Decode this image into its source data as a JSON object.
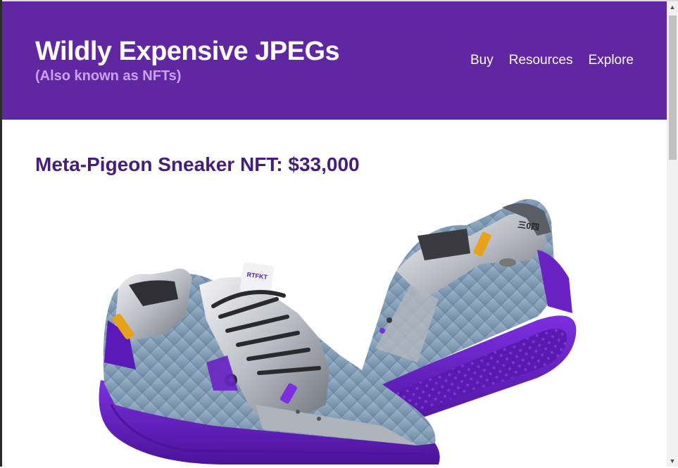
{
  "header": {
    "title": "Wildly Expensive JPEGs",
    "subtitle": "(Also known as NFTs)",
    "nav": [
      {
        "label": "Buy"
      },
      {
        "label": "Resources"
      },
      {
        "label": "Explore"
      }
    ]
  },
  "main": {
    "product_title": "Meta-Pigeon Sneaker NFT: $33,000",
    "image": {
      "subject": "pair of purple and silver sneakers",
      "tongue_text": "RTFKT"
    }
  },
  "colors": {
    "header_bg": "#6127a3",
    "title_text": "#ffffff",
    "subtitle_text": "#c9a2f4",
    "product_title_text": "#451d7a",
    "sole_purple": "#6a1fc2"
  },
  "icons": {
    "scroll_up": "chevron-up-icon",
    "scroll_down": "chevron-down-icon"
  }
}
